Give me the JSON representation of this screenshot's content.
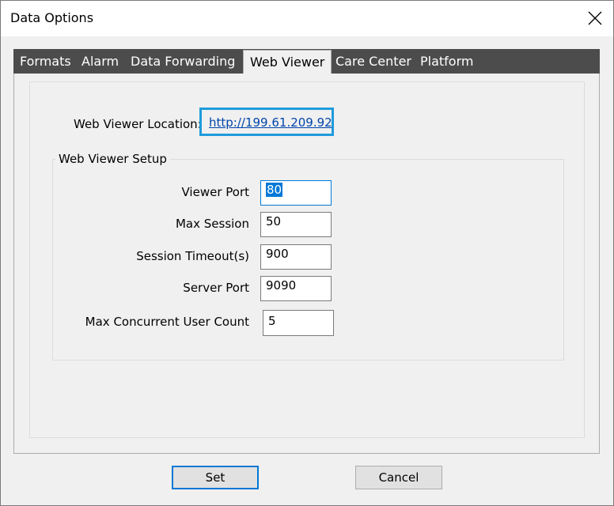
{
  "window": {
    "title": "Data Options",
    "close_icon": "close-icon"
  },
  "tabs": [
    {
      "label": "Formats"
    },
    {
      "label": "Alarm"
    },
    {
      "label": "Data Forwarding"
    },
    {
      "label": "Web Viewer",
      "active": true
    },
    {
      "label": "Care Center"
    },
    {
      "label": "Platform"
    }
  ],
  "location": {
    "label": "Web Viewer Location:",
    "url": "http://199.61.209.92",
    "highlight_color": "#1e9bdc"
  },
  "setup": {
    "title": "Web Viewer Setup",
    "fields": [
      {
        "label": "Viewer Port",
        "value": "80"
      },
      {
        "label": "Max Session",
        "value": "50"
      },
      {
        "label": "Session Timeout(s)",
        "value": "900"
      },
      {
        "label": "Server Port",
        "value": "9090"
      },
      {
        "label": "Max Concurrent User Count",
        "value": "5"
      }
    ]
  },
  "buttons": {
    "set": "Set",
    "cancel": "Cancel"
  },
  "colors": {
    "tabstrip": "#4c4c4c",
    "accent": "#0078d7"
  }
}
